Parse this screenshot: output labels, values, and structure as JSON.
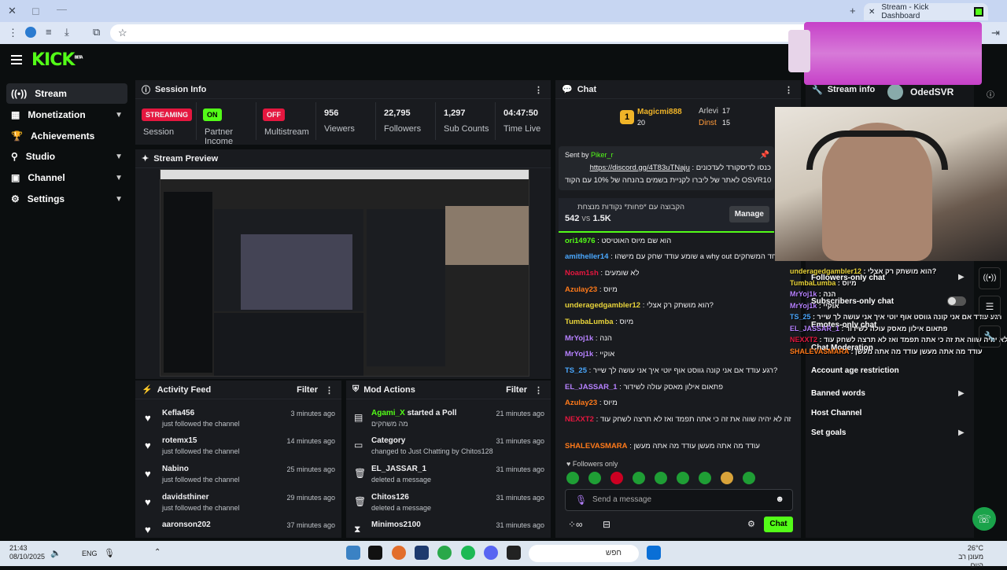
{
  "browser": {
    "tab_title": "Stream - Kick Dashboard",
    "new_tab": "+",
    "close": "✕"
  },
  "brand": {
    "logo": "KICK",
    "beta": "BETA",
    "accent": "#53fc18"
  },
  "sidebar": {
    "items": [
      {
        "label": "Stream",
        "icon": "broadcast-icon",
        "chevron": false
      },
      {
        "label": "Monetization",
        "icon": "money-icon",
        "chevron": true
      },
      {
        "label": "Achievements",
        "icon": "trophy-icon",
        "chevron": false
      },
      {
        "label": "Studio",
        "icon": "studio-icon",
        "chevron": true
      },
      {
        "label": "Channel",
        "icon": "channel-icon",
        "chevron": true
      },
      {
        "label": "Settings",
        "icon": "gear-icon",
        "chevron": true
      }
    ]
  },
  "session": {
    "title": "Session Info",
    "stats": [
      {
        "value": "STREAMING",
        "label": "Session",
        "pill": "#e5173f"
      },
      {
        "value": "ON",
        "label": "Partner Income",
        "pill": "#53fc18"
      },
      {
        "value": "OFF",
        "label": "Multistream",
        "pill": "#e5173f"
      },
      {
        "value": "956",
        "label": "Viewers"
      },
      {
        "value": "22,795",
        "label": "Followers"
      },
      {
        "value": "1,297",
        "label": "Sub Counts"
      },
      {
        "value": "04:47:50",
        "label": "Time Live"
      }
    ]
  },
  "preview": {
    "title": "Stream Preview"
  },
  "activity": {
    "title": "Activity Feed",
    "filter": "Filter",
    "rows": [
      {
        "name": "Kefla456",
        "action": "just followed the channel",
        "time": "3 minutes ago"
      },
      {
        "name": "rotemx15",
        "action": "just followed the channel",
        "time": "14 minutes ago"
      },
      {
        "name": "Nabino",
        "action": "just followed the channel",
        "time": "25 minutes ago"
      },
      {
        "name": "davidsthiner",
        "action": "just followed the channel",
        "time": "29 minutes ago"
      },
      {
        "name": "aaronson202",
        "action": "",
        "time": "37 minutes ago"
      }
    ]
  },
  "mod": {
    "title": "Mod Actions",
    "filter": "Filter",
    "rows": [
      {
        "icon": "poll-icon",
        "name": "Agami_X",
        "name2": "started a Poll",
        "sub": "מה משחקים",
        "time": "21 minutes ago"
      },
      {
        "icon": "category-icon",
        "name": "Category",
        "name2": "",
        "sub": "changed to Just Chatting by Chitos128",
        "time": "31 minutes ago"
      },
      {
        "icon": "trash-icon",
        "name": "EL_JASSAR_1",
        "name2": "",
        "sub": "deleted a message",
        "time": "31 minutes ago"
      },
      {
        "icon": "trash-icon",
        "name": "Chitos126",
        "name2": "",
        "sub": "deleted a message",
        "time": "31 minutes ago"
      },
      {
        "icon": "hourglass-icon",
        "name": "Minimos2100",
        "name2": "",
        "sub": "",
        "time": "31 minutes ago"
      }
    ]
  },
  "chat": {
    "title": "Chat",
    "leaders": [
      {
        "name": "Magicmi888",
        "count": "20"
      },
      {
        "name": "Arlevi",
        "count": "17"
      },
      {
        "name": "Dinst",
        "count": "15"
      }
    ],
    "pinned": {
      "sent_by": "Sent by",
      "user": "Piker_r",
      "line1": "כנסו לדיסקורד לעדכונים :",
      "link": "https://discord.gg/4T83uTNaju",
      "line2": "לאתר של ליברו לקניית בשמים בהנחה של 10% עם הקוד OSVR10..."
    },
    "poll": {
      "title": "הקבוצה עם *פחות* נקודות מנצחת",
      "a": "542",
      "vs": "vs",
      "b": "1.5K",
      "manage": "Manage"
    },
    "messages": [
      {
        "user": "ori14976",
        "text": ": הוא שם מיוס האוטיסט",
        "color": "#53fc18"
      },
      {
        "user": "amitheller14",
        "text": ": שומע עודד שחק עם מישהו a why out אחד המשחקים",
        "color": "#4aa8ff"
      },
      {
        "user": "Noam1sh",
        "text": ": לא שומעים",
        "color": "#e5173f"
      },
      {
        "user": "Azulay23",
        "text": ": מיוס",
        "color": "#ff7a1a"
      },
      {
        "user": "underagedgambler12",
        "text": ": הוא מושתק רק אצלי?",
        "color": "#e9d43a"
      },
      {
        "user": "TumbaLumba",
        "text": ": מיוס",
        "color": "#e9d43a"
      },
      {
        "user": "MrYoj1k",
        "text": ": הנה",
        "color": "#b681ff"
      },
      {
        "user": "MrYoj1k",
        "text": ": אוקיי",
        "color": "#b681ff"
      },
      {
        "user": "TS_25",
        "text": ": רגע עודד אם אני קונה גווסט אוף יוטי איך אני עושה לך שייר?",
        "color": "#4aa8ff"
      },
      {
        "user": "EL_JASSAR_1",
        "text": ": פתאום אילון מאסק עולה לשידור",
        "color": "#b681ff"
      },
      {
        "user": "Azulay23",
        "text": ": מיוס",
        "color": "#ff7a1a"
      },
      {
        "user": "NEXXT2",
        "text": ": זה לא יהיה שווה את זה כי אתה תפמד ואז לא תרצה לשחק עוד",
        "color": "#e5173f"
      },
      {
        "user": "SHALEVASMARA",
        "text": ": עודד מה אתה מעשן עודד מה אתה מעשן",
        "color": "#ff7a1a"
      }
    ],
    "followers_only": "Followers only",
    "placeholder": "Send a message",
    "send": "Chat"
  },
  "streaminfo": {
    "title": "Stream info",
    "user": "OdedSVR",
    "items": [
      "Followers-only chat",
      "Subscribers-only chat",
      "Emotes-only chat",
      "Chat Moderation",
      "Account age restriction",
      "Banned words",
      "Host Channel",
      "Set goals"
    ],
    "overlay_lines": [
      {
        "user": "underagedgambler12",
        "text": ": הוא מושתק רק אצלי?"
      },
      {
        "user": "TumbaLumba",
        "text": ": מיוס"
      },
      {
        "user": "MrYoj1k",
        "text": ": הנה"
      },
      {
        "user": "MrYoj1k",
        "text": ": אוקיי"
      },
      {
        "user": "TS_25",
        "text": ": רגע עודד אם אני קונה גווסט אוף יוטי איך אני עושה לך שייר"
      },
      {
        "user": "EL_JASSAR_1",
        "text": ": פתאום אילון מאסק עולה לשידור"
      },
      {
        "user": "NEXXT2",
        "text": ": זה לא יהיה שווה את זה כי אתה תפמד ואז לא תרצה לשחק עוד"
      },
      {
        "user": "SHALEVASMARA",
        "text": ": עודד מה אתה מעשן עודד מה אתה מעשן"
      }
    ]
  },
  "taskbar": {
    "time": "21:43",
    "date": "08/10/2025",
    "lang": "ENG",
    "search": "חפש",
    "temp": "26°C",
    "weather": "מעונן רב היום"
  }
}
